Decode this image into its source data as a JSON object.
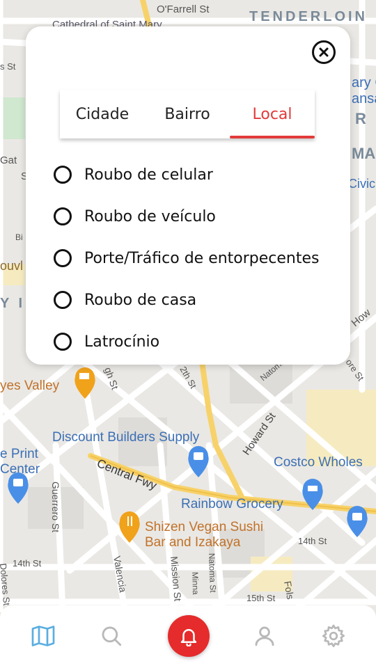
{
  "map": {
    "labels": {
      "ofarrell": "O'Farrell St",
      "tenderloin": "TENDERLOIN",
      "hayes_valley": "yes Valley",
      "discount_builders": "Discount Builders Supply",
      "print_center_1": "e Print",
      "print_center_2": "Center",
      "costco": "Costco Wholes",
      "central_fwy": "Central Fwy",
      "rainbow": "Rainbow Grocery",
      "shizen_1": "Shizen Vegan Sushi",
      "shizen_2": "Bar and Izakaya",
      "howard": "Howard St",
      "natoma_top": "Natoma",
      "guerrero": "Guerrero St",
      "valencia": "Valencia",
      "mission": "Mission St",
      "minna": "Minna",
      "natoma_bottom": "Natoma St",
      "st14_left": "14th St",
      "st14_right": "14th St",
      "st15": "15th St",
      "folsom": "Fols",
      "dolores": "Dolores St",
      "civic": "Civic",
      "gh_st": "gh St",
      "twelfth": "2th St",
      "ary": "ary C",
      "ansa": "ansa",
      "r_letter": "R",
      "ma": "MA",
      "gat": "Gat",
      "how": "How",
      "ore": "ore St",
      "bi": "Bi",
      "ouvl": "ouvl",
      "yi": "Y I",
      "st_frag": "St",
      "st_frag2": "s St",
      "cathedral": "Cathedral of Saint Mary"
    },
    "pin_colors": {
      "blue": "#4a8fe7",
      "orange": "#f0a21b"
    }
  },
  "modal": {
    "tabs": [
      {
        "label": "Cidade",
        "active": false
      },
      {
        "label": "Bairro",
        "active": false
      },
      {
        "label": "Local",
        "active": true
      }
    ],
    "options": [
      {
        "label": "Roubo de celular",
        "selected": false
      },
      {
        "label": "Roubo de veículo",
        "selected": false
      },
      {
        "label": "Porte/Tráfico de entorpecentes",
        "selected": false
      },
      {
        "label": "Roubo de casa",
        "selected": false
      },
      {
        "label": "Latrocínio",
        "selected": false
      }
    ],
    "close_icon": "close-circle-icon"
  },
  "nav": {
    "items": [
      "map-icon",
      "search-icon",
      "bell-icon",
      "user-icon",
      "gear-icon"
    ],
    "accent_color": "#e52b2b",
    "active_color": "#5aaee0"
  }
}
